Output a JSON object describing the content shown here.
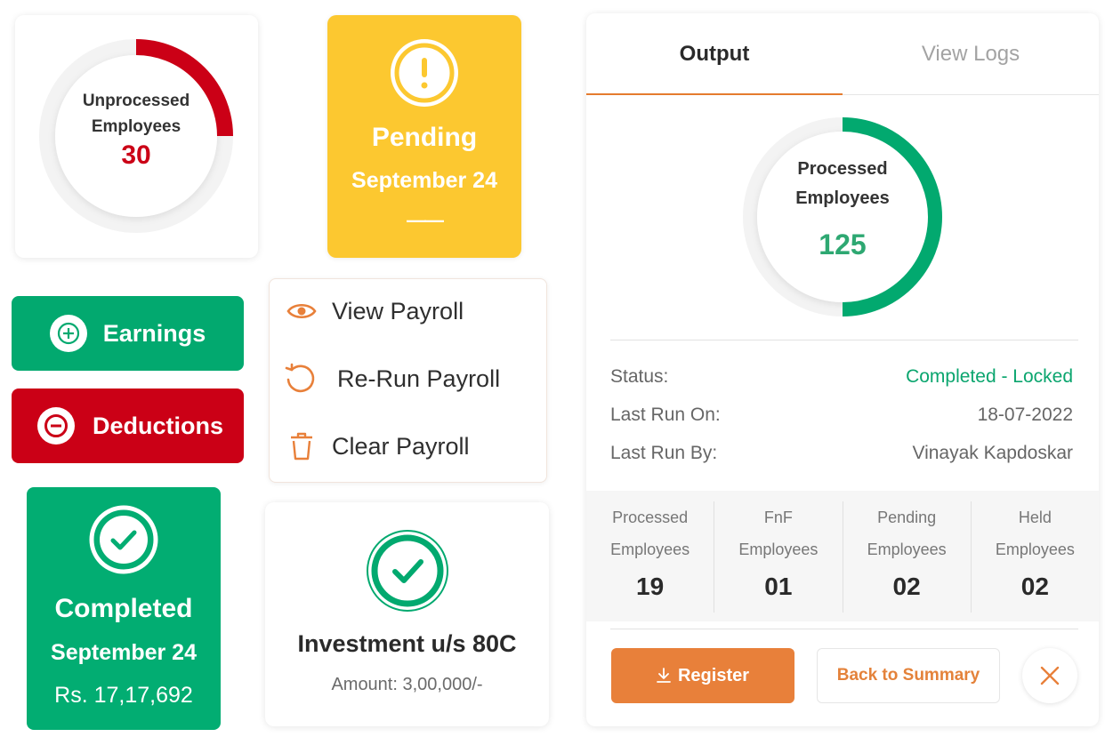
{
  "colors": {
    "green": "#02a96f",
    "red": "#cb0016",
    "yellow": "#fcc830",
    "orange": "#e8803a",
    "ring_track": "#f2f2f2"
  },
  "unprocessed": {
    "label_line1": "Unprocessed",
    "label_line2": "Employees",
    "value": "30",
    "progress_fraction": 0.25
  },
  "pending": {
    "icon": "exclamation-circle-icon",
    "title": "Pending",
    "month": "September 24",
    "amount": "——"
  },
  "earnings_button": {
    "label": "Earnings",
    "icon": "plus-circle-icon"
  },
  "deductions_button": {
    "label": "Deductions",
    "icon": "minus-circle-icon"
  },
  "payroll_menu": {
    "items": [
      {
        "label": "View Payroll",
        "icon": "eye-icon"
      },
      {
        "label": "Re-Run Payroll",
        "icon": "rerun-icon"
      },
      {
        "label": "Clear Payroll",
        "icon": "trash-icon"
      }
    ]
  },
  "completed": {
    "icon": "check-circle-icon",
    "title": "Completed",
    "month": "September 24",
    "amount": "Rs. 17,17,692"
  },
  "investment": {
    "icon": "check-circle-icon",
    "title": "Investment u/s 80C",
    "amount": "Amount: 3,00,000/-"
  },
  "output_panel": {
    "tabs": [
      {
        "label": "Output",
        "active": true
      },
      {
        "label": "View Logs",
        "active": false
      }
    ],
    "processed": {
      "label_line1": "Processed",
      "label_line2": "Employees",
      "value": "125",
      "progress_fraction": 0.5
    },
    "info": [
      {
        "label": "Status:",
        "value": "Completed - Locked"
      },
      {
        "label": "Last Run On:",
        "value": "18-07-2022"
      },
      {
        "label": "Last Run By:",
        "value": "Vinayak Kapdoskar"
      }
    ],
    "stats": [
      {
        "line1": "Processed",
        "line2": "Employees",
        "value": "19"
      },
      {
        "line1": "FnF",
        "line2": "Employees",
        "value": "01"
      },
      {
        "line1": "Pending",
        "line2": "Employees",
        "value": "02"
      },
      {
        "line1": "Held",
        "line2": "Employees",
        "value": "02"
      }
    ],
    "register_label": "Register",
    "back_label": "Back to Summary",
    "close_icon": "close-icon"
  }
}
